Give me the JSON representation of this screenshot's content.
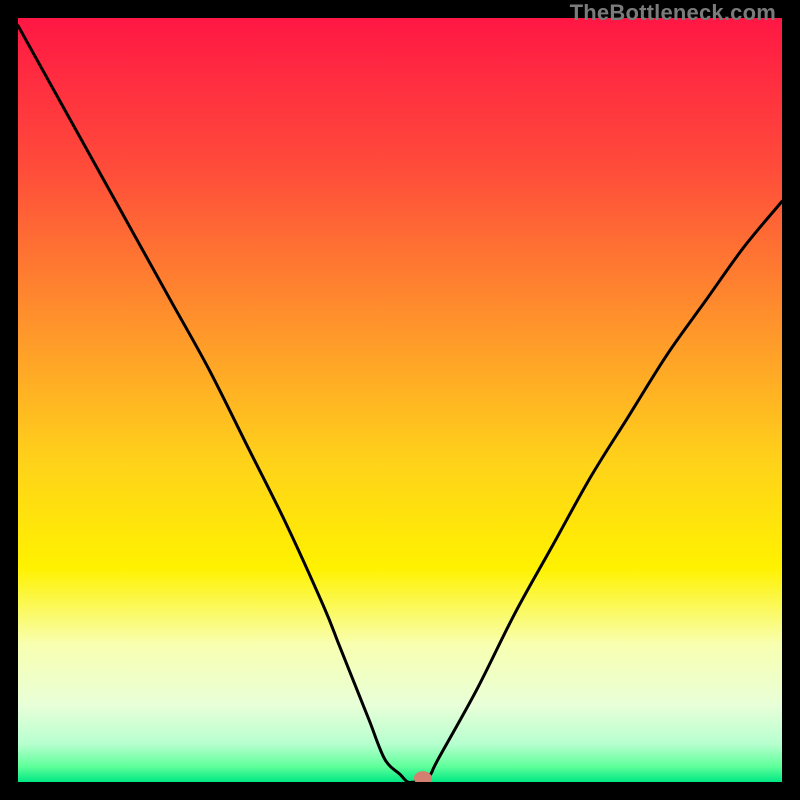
{
  "watermark": "TheBottleneck.com",
  "chart_data": {
    "type": "line",
    "title": "",
    "xlabel": "",
    "ylabel": "",
    "xlim": [
      0,
      100
    ],
    "ylim": [
      0,
      100
    ],
    "grid": false,
    "legend": null,
    "x": [
      0,
      5,
      10,
      15,
      20,
      25,
      30,
      35,
      40,
      42,
      44,
      46,
      48,
      50,
      51,
      52,
      53,
      54,
      55,
      60,
      65,
      70,
      75,
      80,
      85,
      90,
      95,
      100
    ],
    "values": [
      99,
      90,
      81,
      72,
      63,
      54,
      44,
      34,
      23,
      18,
      13,
      8,
      3,
      1,
      0,
      0,
      0,
      1,
      3,
      12,
      22,
      31,
      40,
      48,
      56,
      63,
      70,
      76
    ],
    "marker": {
      "x": 53,
      "y": 0.5,
      "color": "#d48070"
    },
    "background_gradient": {
      "stops": [
        {
          "offset": 0.0,
          "color": "#ff1744"
        },
        {
          "offset": 0.2,
          "color": "#ff4d3a"
        },
        {
          "offset": 0.42,
          "color": "#ff9a2a"
        },
        {
          "offset": 0.58,
          "color": "#ffd21a"
        },
        {
          "offset": 0.72,
          "color": "#fff200"
        },
        {
          "offset": 0.82,
          "color": "#f8ffb0"
        },
        {
          "offset": 0.9,
          "color": "#e8ffd8"
        },
        {
          "offset": 0.95,
          "color": "#b7ffcf"
        },
        {
          "offset": 0.98,
          "color": "#5eff9a"
        },
        {
          "offset": 1.0,
          "color": "#00e884"
        }
      ]
    },
    "curve_color": "#000000",
    "curve_width": 3
  }
}
